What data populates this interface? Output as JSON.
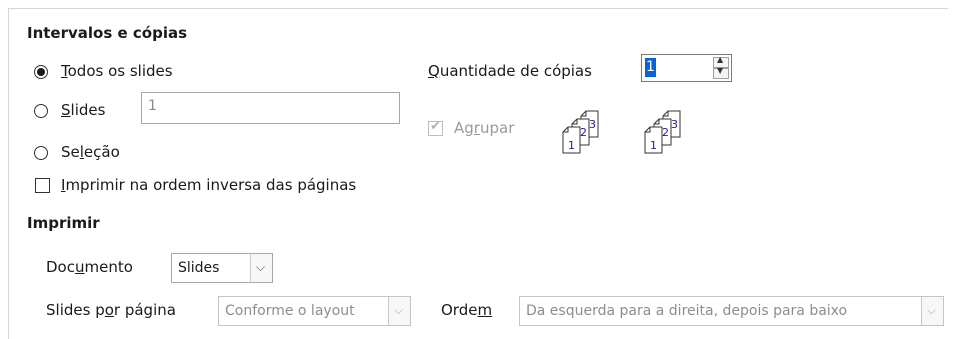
{
  "ranges": {
    "heading": "Intervalos e cópias",
    "all_slides": {
      "prefix_underlined": "T",
      "rest": "odos os slides",
      "selected": true
    },
    "slides": {
      "prefix_underlined": "S",
      "rest": "lides",
      "selected": false,
      "value": "1"
    },
    "selection": {
      "pre": "Se",
      "underlined": "l",
      "rest": "eção",
      "selected": false
    },
    "reverse": {
      "underlined": "I",
      "rest": "mprimir na ordem inversa das páginas",
      "checked": false
    }
  },
  "copies": {
    "label_underlined": "Q",
    "label_rest": "uantidade de cópias",
    "value": "1",
    "collate_pre": "Ag",
    "collate_underlined": "r",
    "collate_rest": "upar",
    "collate_checked": true,
    "page_numbers": [
      "1",
      "2",
      "3"
    ]
  },
  "print": {
    "heading": "Imprimir",
    "document_pre": "Doc",
    "document_underlined": "u",
    "document_rest": "mento",
    "document_value": "Slides",
    "per_page_pre": "Slides p",
    "per_page_underlined": "o",
    "per_page_rest": "r página",
    "per_page_value": "Conforme o layout",
    "order_pre": "Orde",
    "order_underlined": "m",
    "order_value": "Da esquerda para a direita, depois para baixo"
  }
}
